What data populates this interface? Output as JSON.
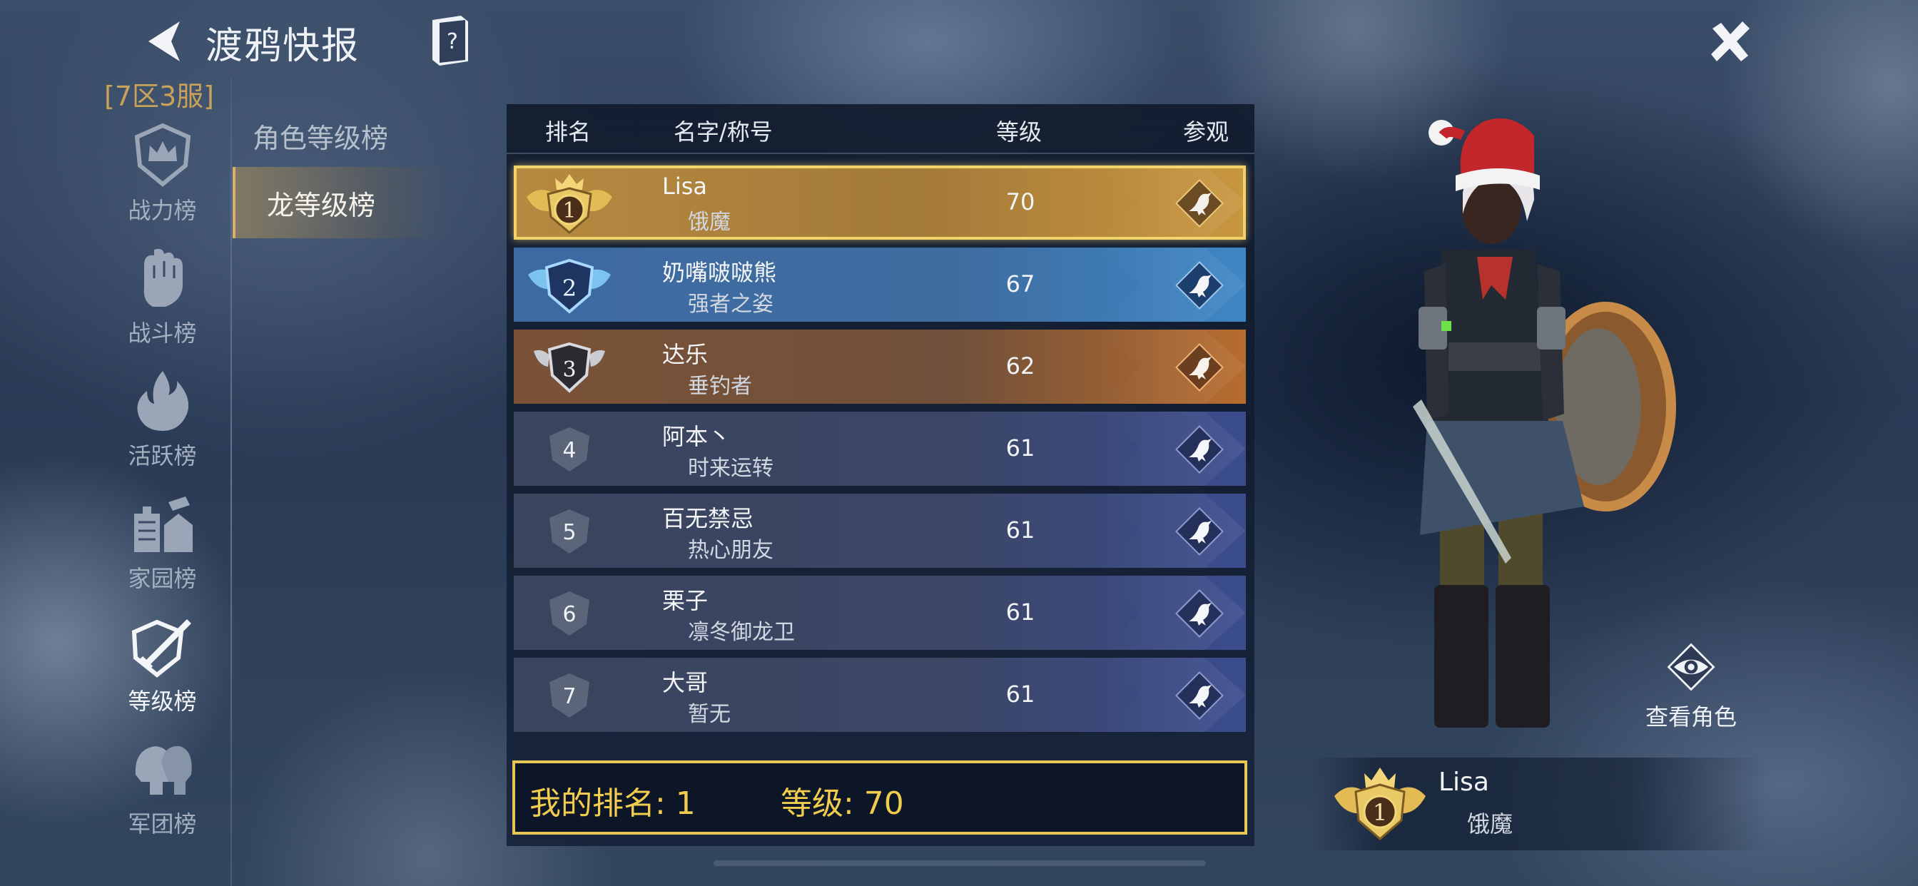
{
  "header": {
    "title": "渡鸦快报",
    "server": "[7区3服]"
  },
  "categories": [
    {
      "label": "战力榜",
      "icon": "crown-shield-icon",
      "active": false
    },
    {
      "label": "战斗榜",
      "icon": "fist-icon",
      "active": false
    },
    {
      "label": "活跃榜",
      "icon": "flame-icon",
      "active": false
    },
    {
      "label": "家园榜",
      "icon": "house-hammer-icon",
      "active": false
    },
    {
      "label": "等级榜",
      "icon": "shield-sword-icon",
      "active": true
    },
    {
      "label": "军团榜",
      "icon": "helmets-icon",
      "active": false
    }
  ],
  "subtabs": [
    {
      "label": "角色等级榜",
      "active": false
    },
    {
      "label": "龙等级榜",
      "active": true
    }
  ],
  "table": {
    "headers": {
      "rank": "排名",
      "name": "名字/称号",
      "level": "等级",
      "view": "参观"
    },
    "rows": [
      {
        "rank": "1",
        "name": "Lisa",
        "title": "饿魔",
        "level": "70"
      },
      {
        "rank": "2",
        "name": "奶嘴啵啵熊",
        "title": "强者之姿",
        "level": "67"
      },
      {
        "rank": "3",
        "name": "达乐",
        "title": "垂钓者",
        "level": "62"
      },
      {
        "rank": "4",
        "name": "阿本丶",
        "title": "时来运转",
        "level": "61"
      },
      {
        "rank": "5",
        "name": "百无禁忌",
        "title": "热心朋友",
        "level": "61"
      },
      {
        "rank": "6",
        "name": "栗子",
        "title": "凛冬御龙卫",
        "level": "61"
      },
      {
        "rank": "7",
        "name": "大哥",
        "title": "暂无",
        "level": "61"
      }
    ]
  },
  "my_rank": {
    "rank_text": "我的排名: 1",
    "level_text": "等级: 70"
  },
  "character_panel": {
    "view_label": "查看角色",
    "player_name": "Lisa",
    "player_title": "饿魔",
    "player_rank": "1"
  },
  "colors": {
    "gold": "#f1cc4e",
    "row1": "#b68a3f",
    "row2": "#3d6aa2",
    "row3": "#7a5238",
    "row_default": "#39445e"
  }
}
